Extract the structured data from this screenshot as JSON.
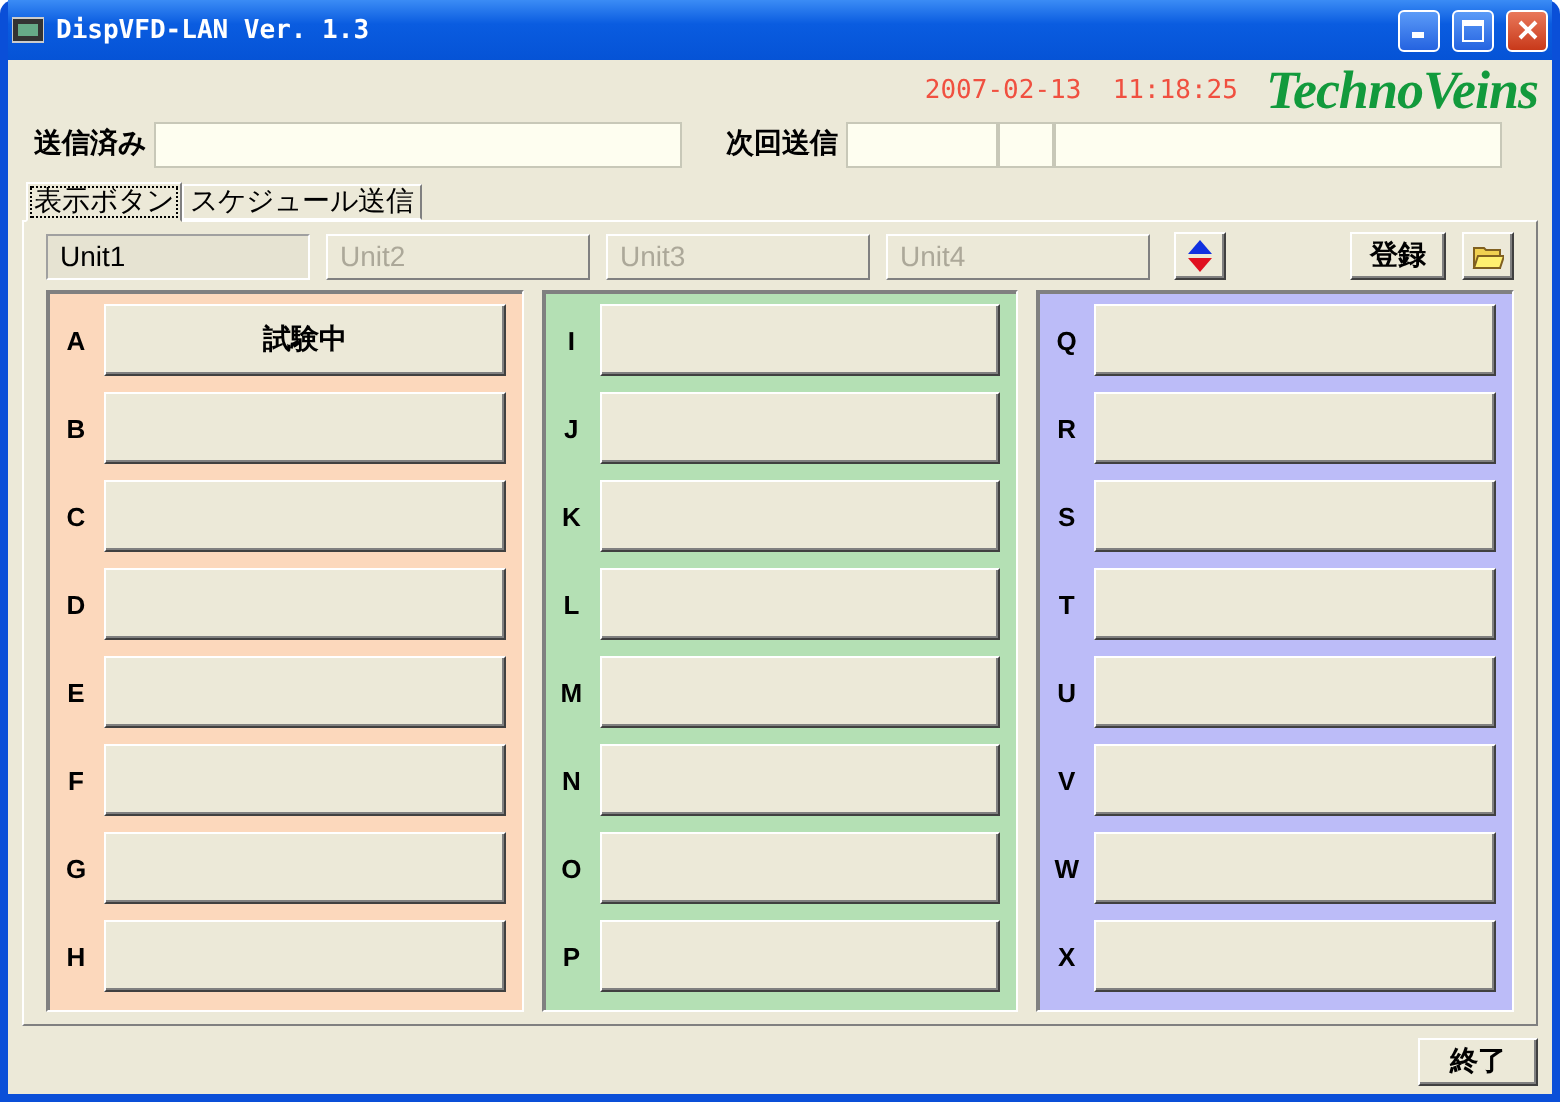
{
  "window": {
    "title": "DispVFD-LAN Ver. 1.3"
  },
  "clock": "2007-02-13  11:18:25",
  "logo": "TechnoVeins",
  "sent_label": "送信済み",
  "next_label": "次回送信",
  "tabs": [
    {
      "label": "表示ボタン",
      "selected": true
    },
    {
      "label": "スケジュール送信",
      "selected": false
    }
  ],
  "units": [
    {
      "label": "Unit1",
      "selected": true
    },
    {
      "label": "Unit2",
      "selected": false
    },
    {
      "label": "Unit3",
      "selected": false
    },
    {
      "label": "Unit4",
      "selected": false
    }
  ],
  "register_button": "登録",
  "groups": [
    {
      "color": "#fcd8bc",
      "rows": [
        {
          "letter": "A",
          "button": "試験中"
        },
        {
          "letter": "B"
        },
        {
          "letter": "C"
        },
        {
          "letter": "D"
        },
        {
          "letter": "E"
        },
        {
          "letter": "F"
        },
        {
          "letter": "G"
        },
        {
          "letter": "H"
        }
      ]
    },
    {
      "color": "#b4e0b4",
      "rows": [
        {
          "letter": "I"
        },
        {
          "letter": "J"
        },
        {
          "letter": "K"
        },
        {
          "letter": "L"
        },
        {
          "letter": "M"
        },
        {
          "letter": "N"
        },
        {
          "letter": "O"
        },
        {
          "letter": "P"
        }
      ]
    },
    {
      "color": "#bcbcf8",
      "rows": [
        {
          "letter": "Q"
        },
        {
          "letter": "R"
        },
        {
          "letter": "S"
        },
        {
          "letter": "T"
        },
        {
          "letter": "U"
        },
        {
          "letter": "V"
        },
        {
          "letter": "W"
        },
        {
          "letter": "X"
        }
      ]
    }
  ],
  "close_button": "終了"
}
